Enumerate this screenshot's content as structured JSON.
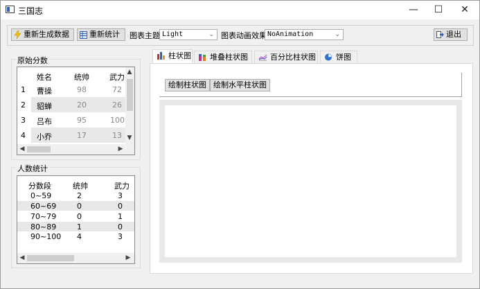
{
  "window": {
    "title": "三国志",
    "minimize": "—",
    "maximize": "☐",
    "close": "✕"
  },
  "toolbar": {
    "regenerate_label": "重新生成数据",
    "recount_label": "重新统计",
    "theme_label": "图表主题",
    "theme_value": "Light",
    "animation_label": "图表动画效果",
    "animation_value": "NoAnimation",
    "exit_label": "退出"
  },
  "raw_scores": {
    "title": "原始分数",
    "columns": [
      "姓名",
      "统帅",
      "武力"
    ],
    "rows": [
      {
        "index": "1",
        "name": "曹操",
        "command": "98",
        "force": "72"
      },
      {
        "index": "2",
        "name": "貂蝉",
        "command": "20",
        "force": "26"
      },
      {
        "index": "3",
        "name": "吕布",
        "command": "95",
        "force": "100"
      },
      {
        "index": "4",
        "name": "小乔",
        "command": "17",
        "force": "13"
      }
    ]
  },
  "stats": {
    "title": "人数统计",
    "columns": [
      "分数段",
      "统帅",
      "武力"
    ],
    "rows": [
      {
        "range": "0~59",
        "command": "2",
        "force": "3"
      },
      {
        "range": "60~69",
        "command": "0",
        "force": "0"
      },
      {
        "range": "70~79",
        "command": "0",
        "force": "1"
      },
      {
        "range": "80~89",
        "command": "1",
        "force": "0"
      },
      {
        "range": "90~100",
        "command": "4",
        "force": "3"
      }
    ]
  },
  "tabs": [
    {
      "label": "柱状图",
      "icon": "bar-chart-icon"
    },
    {
      "label": "堆叠柱状图",
      "icon": "stacked-bar-chart-icon"
    },
    {
      "label": "百分比柱状图",
      "icon": "percent-bar-chart-icon"
    },
    {
      "label": "饼图",
      "icon": "pie-chart-icon"
    }
  ],
  "bar_tab": {
    "draw_bar_label": "绘制柱状图",
    "draw_hbar_label": "绘制水平柱状图"
  },
  "colors": {
    "accent": "#2f5fbf",
    "alt_row": "#e8e8e8"
  }
}
